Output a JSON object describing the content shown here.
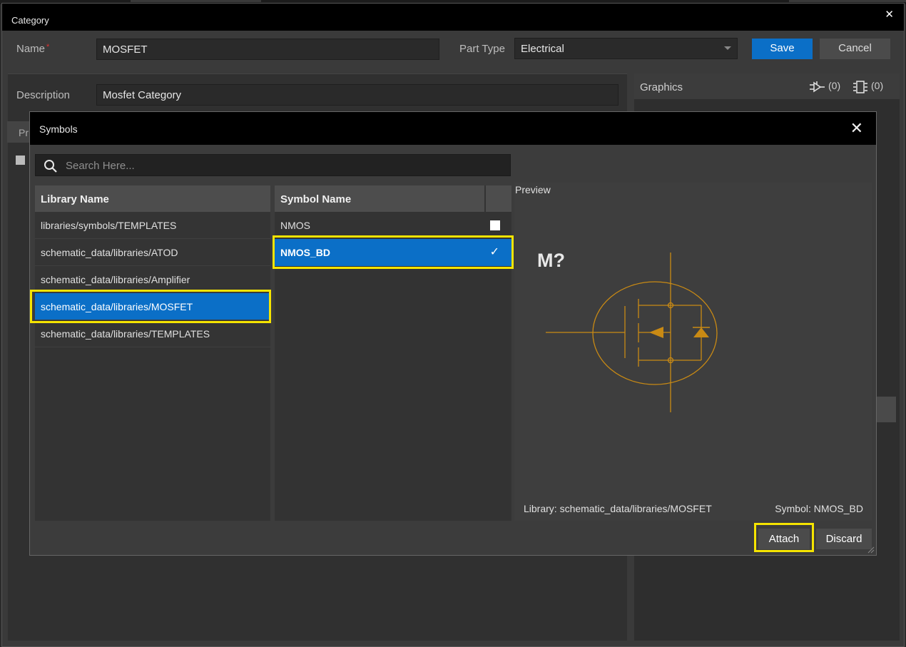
{
  "category": {
    "title": "Category",
    "name_label": "Name",
    "required_mark": "*",
    "name_value": "MOSFET",
    "part_type_label": "Part Type",
    "part_type_value": "Electrical",
    "save_label": "Save",
    "cancel_label": "Cancel",
    "description_label": "Description",
    "description_value": "Mosfet Category",
    "tab_stub": "Pr",
    "graphics": {
      "title": "Graphics",
      "symbol_count": "(0)",
      "footprint_count": "(0)"
    }
  },
  "symbols_dialog": {
    "title": "Symbols",
    "search_placeholder": "Search Here...",
    "library_header": "Library Name",
    "symbol_header": "Symbol Name",
    "libraries": [
      "libraries/symbols/TEMPLATES",
      "schematic_data/libraries/ATOD",
      "schematic_data/libraries/Amplifier",
      "schematic_data/libraries/MOSFET",
      "schematic_data/libraries/TEMPLATES"
    ],
    "selected_library_index": 3,
    "symbols": [
      {
        "name": "NMOS",
        "checked": false
      },
      {
        "name": "NMOS_BD",
        "checked": true
      }
    ],
    "preview": {
      "label": "Preview",
      "refdes": "M?",
      "library_text": "Library: schematic_data/libraries/MOSFET",
      "symbol_text": "Symbol: NMOS_BD"
    },
    "attach_label": "Attach",
    "discard_label": "Discard"
  },
  "colors": {
    "accent": "#0b6fc7",
    "highlight": "#f5e400",
    "symbol_stroke": "#c98a14"
  },
  "icons": [
    "close-icon",
    "search-icon",
    "symbol-icon",
    "footprint-icon",
    "caret-down-icon",
    "checkbox-icon",
    "checkmark-icon",
    "resize-grip-icon"
  ]
}
